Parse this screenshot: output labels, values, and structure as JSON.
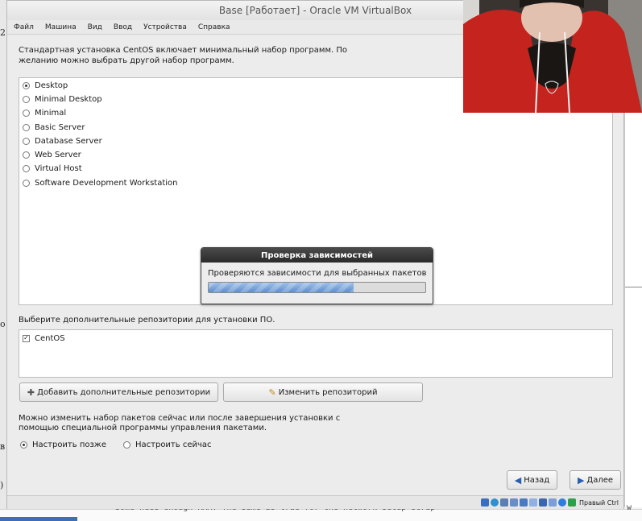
{
  "window": {
    "title": "Base [Работает] - Oracle VM VirtualBox"
  },
  "menu": [
    "Файл",
    "Машина",
    "Вид",
    "Ввод",
    "Устройства",
    "Справка"
  ],
  "installer": {
    "intro": "Стандартная установка CentOS включает минимальный набор программ. По желанию можно выбрать другой набор программ.",
    "options": [
      {
        "label": "Desktop",
        "selected": true
      },
      {
        "label": "Minimal Desktop",
        "selected": false
      },
      {
        "label": "Minimal",
        "selected": false
      },
      {
        "label": "Basic Server",
        "selected": false
      },
      {
        "label": "Database Server",
        "selected": false
      },
      {
        "label": "Web Server",
        "selected": false
      },
      {
        "label": "Virtual Host",
        "selected": false
      },
      {
        "label": "Software Development Workstation",
        "selected": false
      }
    ],
    "dialog": {
      "title": "Проверка зависимостей",
      "message": "Проверяются зависимости для выбранных пакетов",
      "progress": 0.67
    },
    "repo_label": "Выберите дополнительные репозитории для установки ПО.",
    "repos": [
      {
        "label": "CentOS",
        "checked": true
      }
    ],
    "add_repo_label": "Добавить дополнительные репозитории",
    "edit_repo_label": "Изменить репозиторий",
    "change_note": "Можно изменить набор пакетов сейчас или после завершения установки с помощью специальной программы управления пакетами.",
    "customize": [
      {
        "label": "Настроить позже",
        "selected": true
      },
      {
        "label": "Настроить сейчас",
        "selected": false
      }
    ],
    "back_label": "Назад",
    "next_label": "Далее"
  },
  "statusbar": {
    "host_key": "Правый Ctrl"
  },
  "background": {
    "left_fragments": [
      "2",
      "o",
      "в",
      ")"
    ],
    "code_line": "Some need enough RAM. The same is true for the network setup-script (",
    "code_tail": "w"
  },
  "colors": {
    "accent": "#5f8fcb",
    "dialog_title_bg": "#2b2b2b",
    "hoodie": "#c4231e"
  }
}
